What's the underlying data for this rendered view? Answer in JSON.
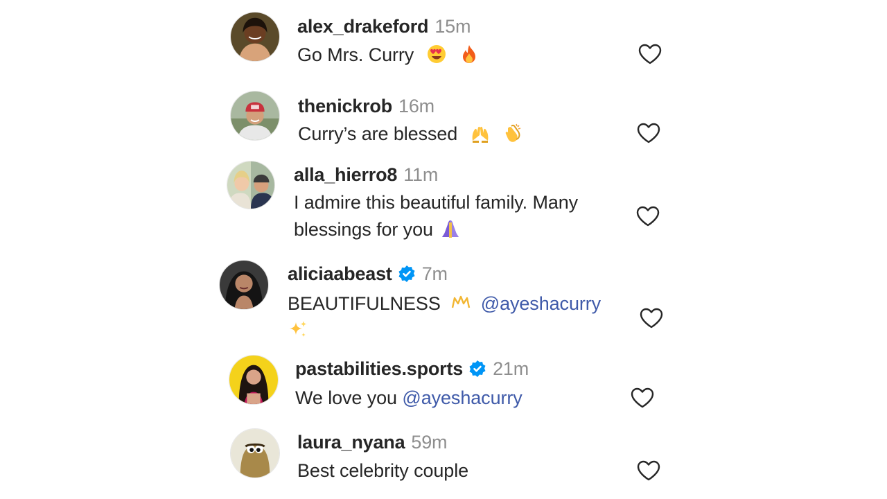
{
  "comments": [
    {
      "username": "alex_drakeford",
      "time": "15m",
      "verified": false,
      "text": "Go Mrs. Curry",
      "emojis": [
        "heart-eyes-emoji-icon",
        "fire-emoji-icon"
      ]
    },
    {
      "username": "thenickrob",
      "time": "16m",
      "verified": false,
      "text": "Curry’s are blessed",
      "emojis": [
        "raising-hands-emoji-icon",
        "clapping-hands-emoji-icon"
      ]
    },
    {
      "username": "alla_hierro8",
      "time": "11m",
      "verified": false,
      "text_line1": "I admire this beautiful family. Many",
      "text_line2": "blessings for you",
      "emojis": [
        "folded-hands-emoji-icon"
      ]
    },
    {
      "username": "aliciaabeast",
      "time": "7m",
      "verified": true,
      "text": "BEAUTIFULNESS",
      "mention": "@ayeshacurry",
      "emojis": [
        "crown-emoji-icon",
        "sparkles-emoji-icon"
      ]
    },
    {
      "username": "pastabilities.sports",
      "time": "21m",
      "verified": true,
      "text": "We love you",
      "mention": "@ayeshacurry",
      "emojis": []
    },
    {
      "username": "laura_nyana",
      "time": "59m",
      "verified": false,
      "text": "Best celebrity couple",
      "emojis": []
    }
  ],
  "colors": {
    "username": "#262626",
    "timestamp": "#8e8e8e",
    "mention": "#3f5aa9",
    "verified_badge": "#0095f6",
    "heart_outline": "#262626"
  }
}
